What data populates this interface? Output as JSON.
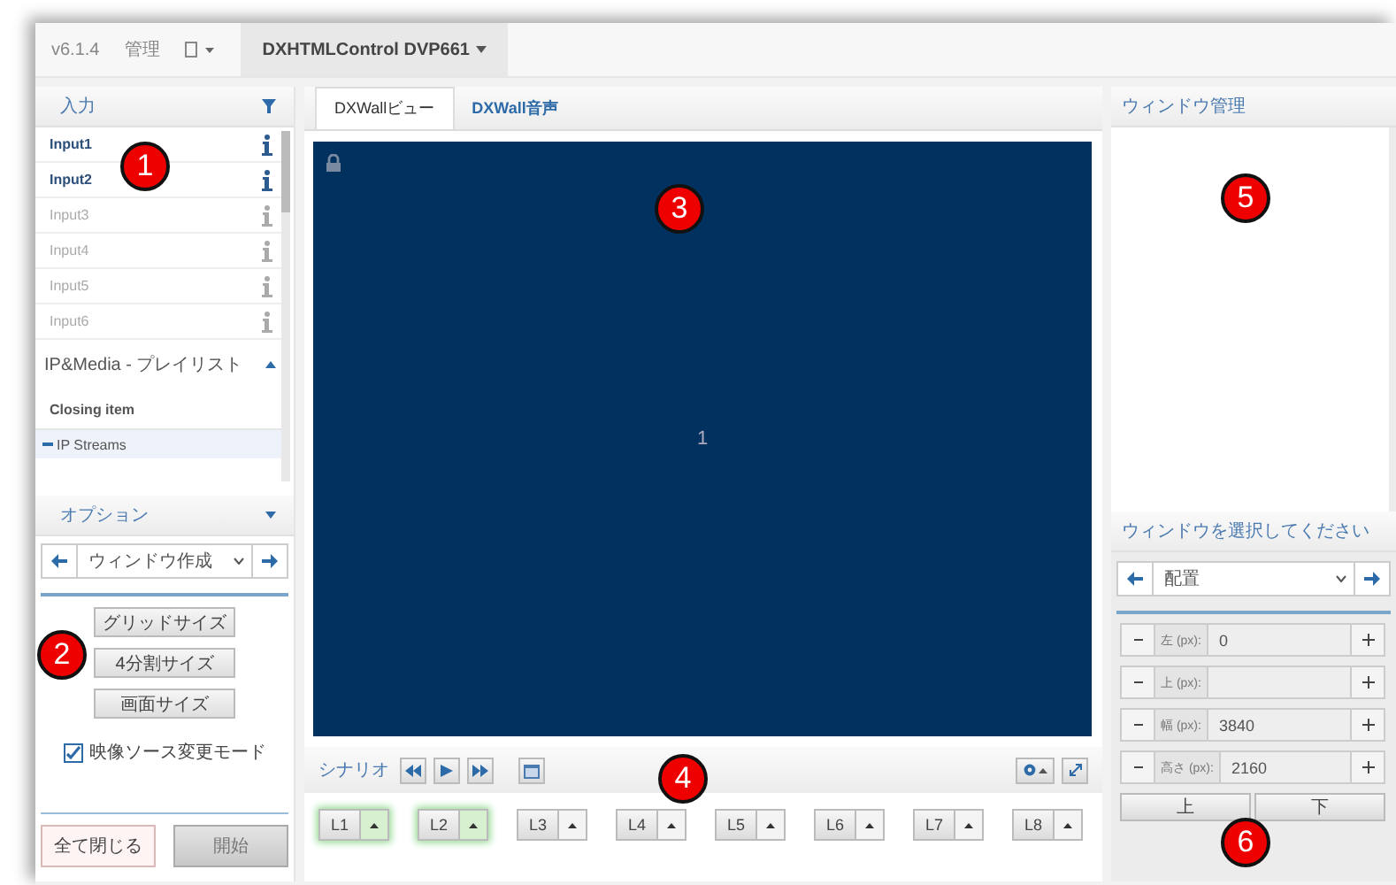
{
  "top_bar": {
    "version": "v6.1.4",
    "menu": "管理",
    "device": "DXHTMLControl DVP661"
  },
  "input_panel": {
    "title": "入力",
    "items": [
      {
        "label": "Input1",
        "enabled": true
      },
      {
        "label": "Input2",
        "enabled": true
      },
      {
        "label": "Input3",
        "enabled": false
      },
      {
        "label": "Input4",
        "enabled": false
      },
      {
        "label": "Input5",
        "enabled": false
      },
      {
        "label": "Input6",
        "enabled": false
      }
    ]
  },
  "playlist": {
    "title": "IP&Media - プレイリスト",
    "expanded": true,
    "items": [
      "Closing item"
    ],
    "streams": "IP Streams"
  },
  "options": {
    "title": "オプション",
    "select": "ウィンドウ作成",
    "buttons": [
      "グリッドサイズ",
      "4分割サイズ",
      "画面サイズ"
    ],
    "checkbox": {
      "label": "映像ソース変更モード",
      "checked": true
    }
  },
  "footer_buttons": [
    {
      "label": "全て閉じる",
      "kind": "danger",
      "disabled": false
    },
    {
      "label": "開始",
      "kind": "plain",
      "disabled": true
    }
  ],
  "tabs": [
    {
      "label": "DXWallビュー",
      "selected": true
    },
    {
      "label": "DXWall音声",
      "selected": false
    }
  ],
  "wall": {
    "screen": "1",
    "locked": true
  },
  "scenario": {
    "label": "シナリオ"
  },
  "layers": [
    {
      "label": "L1",
      "active": true
    },
    {
      "label": "L2",
      "active": true
    },
    {
      "label": "L3",
      "active": false
    },
    {
      "label": "L4",
      "active": false
    },
    {
      "label": "L5",
      "active": false
    },
    {
      "label": "L6",
      "active": false
    },
    {
      "label": "L7",
      "active": false
    },
    {
      "label": "L8",
      "active": false
    }
  ],
  "window_panel": {
    "title": "ウィンドウ管理",
    "select_title": "ウィンドウを選択してください",
    "select": "配置",
    "fields": [
      {
        "label": "左 (px):",
        "value": "0"
      },
      {
        "label": "上 (px):"
      },
      {
        "label": "幅 (px):",
        "value": "3840"
      },
      {
        "label": "高さ (px):",
        "value": "2160"
      }
    ],
    "buttons": [
      "上",
      "下"
    ]
  },
  "callouts": [
    "1",
    "2",
    "3",
    "4",
    "5",
    "6"
  ]
}
